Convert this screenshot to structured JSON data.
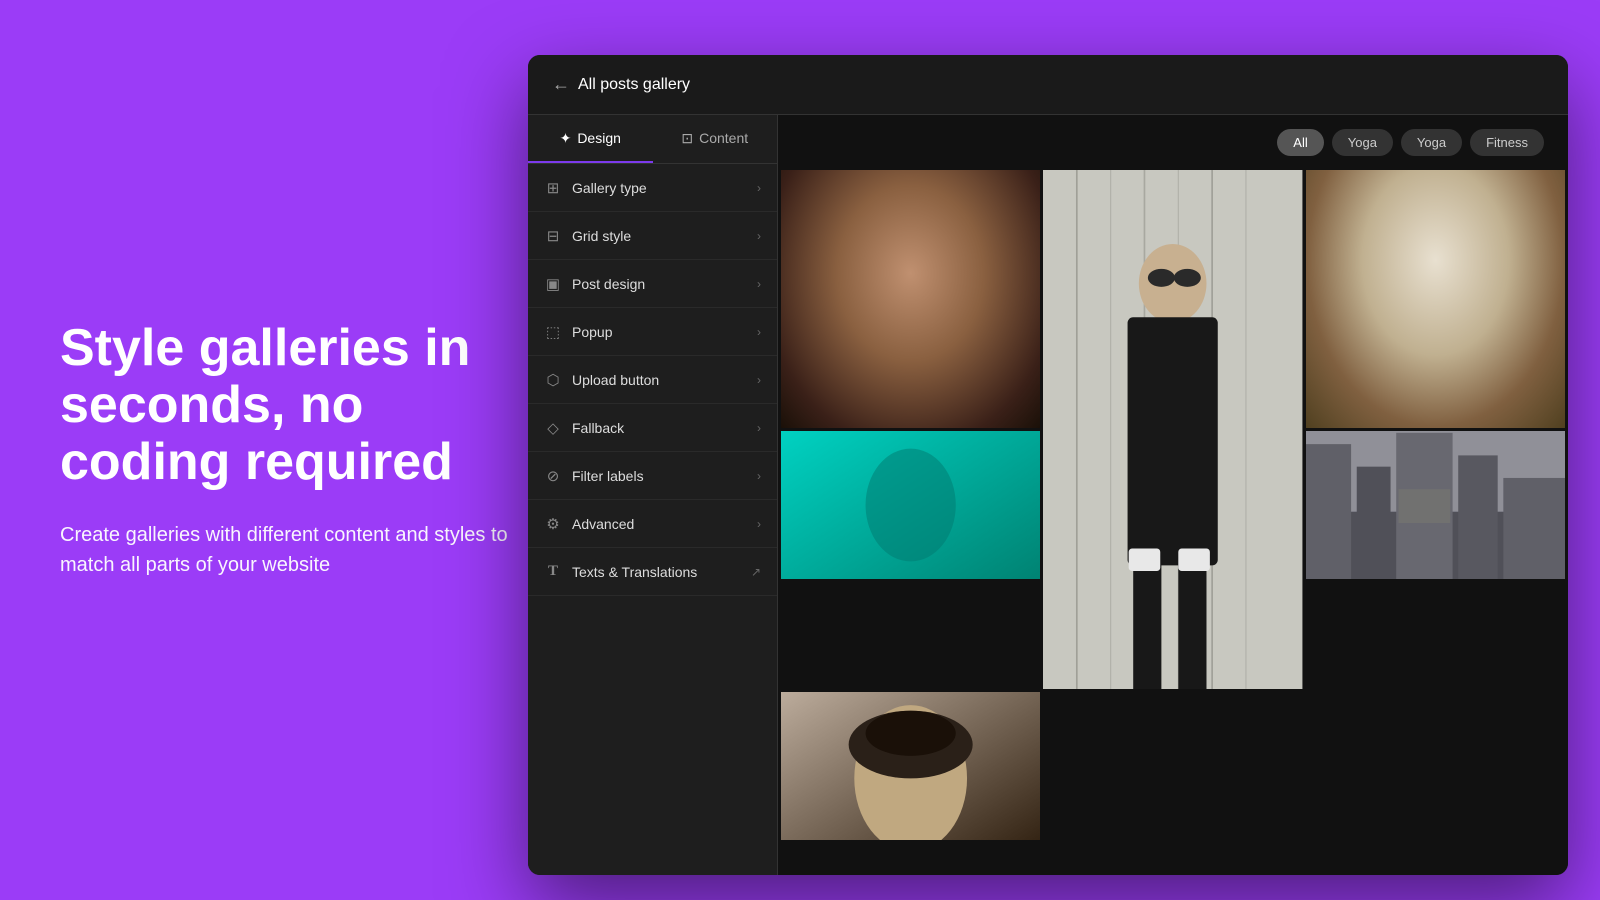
{
  "left": {
    "headline": "Style galleries in seconds, no coding required",
    "subtext": "Create galleries with different content and styles to match all parts of your website"
  },
  "header": {
    "back_label": "All posts gallery",
    "title": "All posts gallery"
  },
  "tabs": [
    {
      "id": "design",
      "label": "Design",
      "active": true
    },
    {
      "id": "content",
      "label": "Content",
      "active": false
    }
  ],
  "menu_items": [
    {
      "id": "gallery-type",
      "icon": "⊞",
      "label": "Gallery type",
      "action": "chevron"
    },
    {
      "id": "grid-style",
      "icon": "⊟",
      "label": "Grid style",
      "action": "chevron"
    },
    {
      "id": "post-design",
      "icon": "▣",
      "label": "Post design",
      "action": "chevron"
    },
    {
      "id": "popup",
      "icon": "⬚",
      "label": "Popup",
      "action": "chevron"
    },
    {
      "id": "upload-button",
      "icon": "⬡",
      "label": "Upload button",
      "action": "chevron"
    },
    {
      "id": "fallback",
      "icon": "◇",
      "label": "Fallback",
      "action": "chevron"
    },
    {
      "id": "filter-labels",
      "icon": "⊘",
      "label": "Filter labels",
      "action": "chevron"
    },
    {
      "id": "advanced",
      "icon": "⚙",
      "label": "Advanced",
      "action": "chevron"
    },
    {
      "id": "texts-translations",
      "icon": "T",
      "label": "Texts & Translations",
      "action": "external"
    }
  ],
  "filter_buttons": [
    {
      "id": "all",
      "label": "All",
      "active": true
    },
    {
      "id": "yoga1",
      "label": "Yoga",
      "active": false
    },
    {
      "id": "yoga2",
      "label": "Yoga",
      "active": false
    },
    {
      "id": "fitness",
      "label": "Fitness",
      "active": false
    }
  ],
  "colors": {
    "accent": "#7c3aed",
    "bg_dark": "#1a1a1a",
    "sidebar_bg": "#1e1e1e",
    "gallery_bg": "#111111"
  }
}
